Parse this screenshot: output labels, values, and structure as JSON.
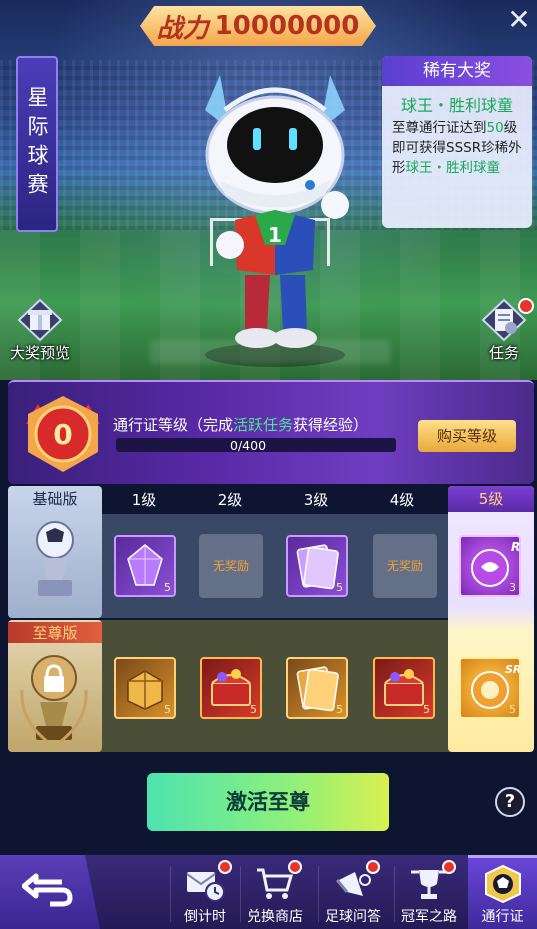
{
  "header": {
    "power_label": "战力",
    "power_value": "10000000"
  },
  "event_tag": "星际球赛",
  "rare_prize": {
    "title": "稀有大奖",
    "name": "球王・胜利球童",
    "desc_prefix": "至尊通行证达到",
    "desc_level": "50",
    "desc_middle": "级即可获得SSSR珍稀外形",
    "desc_item": "球王・胜利球童"
  },
  "corner_left": {
    "label": "大奖预览"
  },
  "corner_right": {
    "label": "任务"
  },
  "level_panel": {
    "level": "0",
    "text_prefix": "通行证等级（完成",
    "text_highlight": "活跃任务",
    "text_suffix": "获得经验）",
    "progress_text": "0/400",
    "progress": 0,
    "buy_label": "购买等级"
  },
  "grid": {
    "basic_label": "基础版",
    "premium_label": "至尊版",
    "levels": [
      "1级",
      "2级",
      "3级",
      "4级",
      "5级"
    ],
    "no_reward": "无奖励",
    "basic_rewards": [
      {
        "icon": "purple-crystal-icon",
        "qty": "5"
      },
      {
        "icon": "none",
        "qty": ""
      },
      {
        "icon": "purple-card-icon",
        "qty": "5"
      },
      {
        "icon": "none",
        "qty": ""
      },
      {
        "icon": "r-zodiac-icon",
        "qty": "3",
        "badge": "R"
      }
    ],
    "premium_rewards": [
      {
        "icon": "gold-box-icon",
        "qty": "5"
      },
      {
        "icon": "red-treasure-chest-icon",
        "qty": "5"
      },
      {
        "icon": "gold-card-icon",
        "qty": "5"
      },
      {
        "icon": "red-treasure-chest-icon",
        "qty": "5"
      },
      {
        "icon": "sr-lion-icon",
        "qty": "5",
        "badge": "SR"
      }
    ]
  },
  "activate_label": "激活至尊",
  "help_label": "?",
  "bottom_nav": [
    {
      "label": "倒计时",
      "icon": "envelope-clock-icon",
      "dot": true
    },
    {
      "label": "兑换商店",
      "icon": "shopping-cart-icon",
      "dot": true
    },
    {
      "label": "足球问答",
      "icon": "megaphone-icon",
      "dot": true
    },
    {
      "label": "冠军之路",
      "icon": "trophy-icon",
      "dot": true
    },
    {
      "label": "通行证",
      "icon": "ball-badge-icon",
      "dot": false,
      "active": true
    }
  ],
  "colors": {
    "accent_green": "#4de38f",
    "panel_purple": "#5a2aa8",
    "gold": "#f3a64a"
  }
}
